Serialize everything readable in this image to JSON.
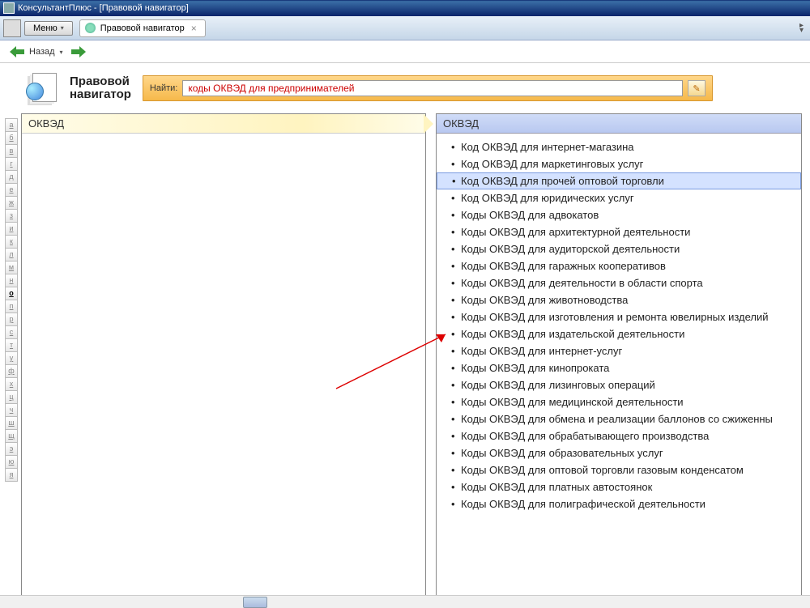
{
  "window": {
    "title": "КонсультантПлюс - [Правовой навигатор]"
  },
  "menu": {
    "label": "Меню"
  },
  "tab": {
    "label": "Правовой навигатор"
  },
  "nav": {
    "back": "Назад"
  },
  "page": {
    "title_line1": "Правовой",
    "title_line2": "навигатор"
  },
  "search": {
    "label": "Найти:",
    "value": "коды ОКВЭД для предпринимателей"
  },
  "left_panel": {
    "header": "ОКВЭД"
  },
  "right_panel": {
    "header": "ОКВЭД"
  },
  "alpha": [
    "а",
    "б",
    "в",
    "г",
    "д",
    "е",
    "ж",
    "з",
    "и",
    "к",
    "л",
    "м",
    "н",
    "о",
    "п",
    "р",
    "с",
    "т",
    "у",
    "ф",
    "х",
    "ц",
    "ч",
    "ш",
    "щ",
    "э",
    "ю",
    "я"
  ],
  "alpha_active": "о",
  "items": [
    "Код ОКВЭД для интернет-магазина",
    "Код ОКВЭД для маркетинговых услуг",
    "Код ОКВЭД для прочей оптовой торговли",
    "Код ОКВЭД для юридических услуг",
    "Коды ОКВЭД для адвокатов",
    "Коды ОКВЭД для архитектурной деятельности",
    "Коды ОКВЭД для аудиторской деятельности",
    "Коды ОКВЭД для гаражных кооперативов",
    "Коды ОКВЭД для деятельности в области спорта",
    "Коды ОКВЭД для животноводства",
    "Коды ОКВЭД для изготовления и ремонта ювелирных изделий",
    "Коды ОКВЭД для издательской деятельности",
    "Коды ОКВЭД для интернет-услуг",
    "Коды ОКВЭД для кинопроката",
    "Коды ОКВЭД для лизинговых операций",
    "Коды ОКВЭД для медицинской деятельности",
    "Коды ОКВЭД для обмена и реализации баллонов со сжиженны",
    "Коды ОКВЭД для обрабатывающего производства",
    "Коды ОКВЭД для образовательных услуг",
    "Коды ОКВЭД для оптовой торговли газовым конденсатом",
    "Коды ОКВЭД для платных автостоянок",
    "Коды ОКВЭД для полиграфической деятельности"
  ],
  "selected_index": 2
}
